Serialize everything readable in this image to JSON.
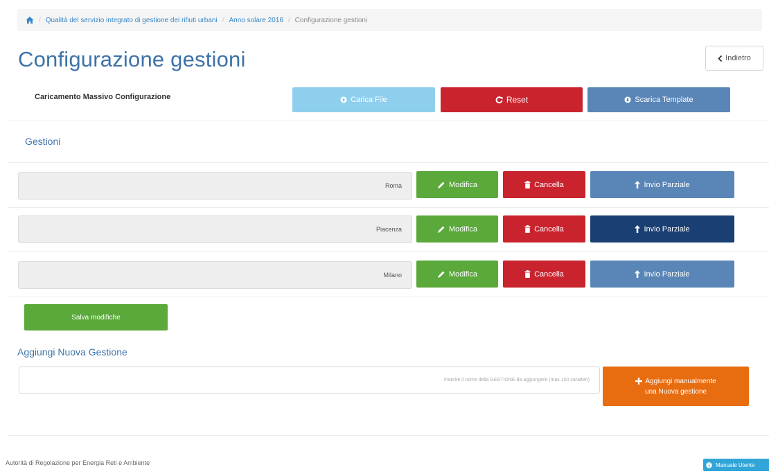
{
  "breadcrumb": {
    "items": [
      "Qualità del servizio integrato di gestione dei rifiuti urbani",
      "Anno solare 2016",
      "Configurazione gestioni"
    ]
  },
  "page": {
    "title": "Configurazione gestioni",
    "back_label": "Indietro"
  },
  "bulk": {
    "label": "Caricamento Massivo Configurazione",
    "upload_label": "Carica File",
    "reset_label": "Reset",
    "template_label": "Scarica Template"
  },
  "gestioni": {
    "title": "Gestioni",
    "rows": [
      {
        "name": "Roma",
        "edit_label": "Modifica",
        "delete_label": "Cancella",
        "send_label": "Invio Parziale"
      },
      {
        "name": "Piacenza",
        "edit_label": "Modifica",
        "delete_label": "Cancella",
        "send_label": "Invio Parziale"
      },
      {
        "name": "Milano",
        "edit_label": "Modifica",
        "delete_label": "Cancella",
        "send_label": "Invio Parziale"
      }
    ],
    "save_label": "Salva modifiche"
  },
  "add": {
    "title": "Aggiungi Nuova Gestione",
    "placeholder": "Inserire il nome della GESTIONE da aggiungere (max 100 caratteri)",
    "button_line1": "Aggiungi manualmente",
    "button_line2": "una Nuova gestione"
  },
  "footer": {
    "text": "Autorità di Regolazione per Energia Reti e Ambiente",
    "manual_label": "Manuale Utente"
  },
  "colors": {
    "title_blue": "#3d73a8",
    "upload": "#8fcfee",
    "danger": "#c9232d",
    "primary_muted": "#5a86b7",
    "primary_active": "#1a3f73",
    "success": "#5aa93a",
    "warning": "#e86c10",
    "info": "#31a5d8"
  }
}
